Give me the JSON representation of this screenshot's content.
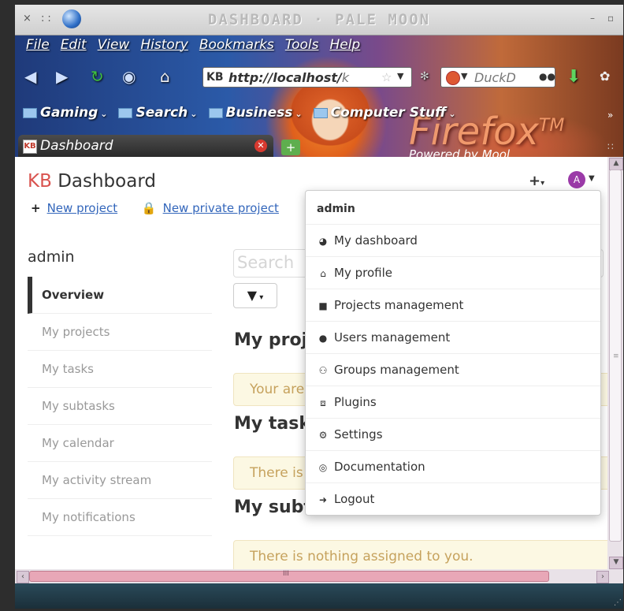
{
  "window": {
    "title": "DASHBOARD · PALE MOON",
    "controls_left": "× ::",
    "minimize": "–",
    "maximize": "▫"
  },
  "menubar": [
    "File",
    "Edit",
    "View",
    "History",
    "Bookmarks",
    "Tools",
    "Help"
  ],
  "navbar": {
    "url_prefix": "KB",
    "url_host": "http://localhost/",
    "url_rest": "k",
    "search_text": "DuckD"
  },
  "bookmarks": [
    "Gaming",
    "Search",
    "Business",
    "Computer Stuff"
  ],
  "persona": {
    "brand": "Firefox",
    "tm": "TM",
    "powered": "Powered by Mool"
  },
  "tab": {
    "icon": "KB",
    "label": "Dashboard"
  },
  "page": {
    "title_prefix": "KB",
    "title": "Dashboard",
    "new_project": "New project",
    "new_private_project": "New private project",
    "user_initial": "A",
    "sidebar_title": "admin",
    "sidebar_items": [
      "Overview",
      "My projects",
      "My tasks",
      "My subtasks",
      "My calendar",
      "My activity stream",
      "My notifications"
    ],
    "search_placeholder": "Search",
    "sections": {
      "projects": "My proj",
      "tasks": "My task",
      "subtasks": "My subt"
    },
    "alerts": {
      "projects": "Your are",
      "tasks": "There is",
      "subtasks": "There is nothing assigned to you."
    }
  },
  "dropdown": {
    "header": "admin",
    "items": [
      {
        "label": "My dashboard",
        "icon": "dashboard-icon"
      },
      {
        "label": "My profile",
        "icon": "home-icon"
      },
      {
        "label": "Projects management",
        "icon": "folder-icon"
      },
      {
        "label": "Users management",
        "icon": "user-icon"
      },
      {
        "label": "Groups management",
        "icon": "group-icon"
      },
      {
        "label": "Plugins",
        "icon": "cubes-icon"
      },
      {
        "label": "Settings",
        "icon": "gear-icon"
      },
      {
        "label": "Documentation",
        "icon": "lifebuoy-icon"
      },
      {
        "label": "Logout",
        "icon": "logout-icon"
      }
    ]
  }
}
